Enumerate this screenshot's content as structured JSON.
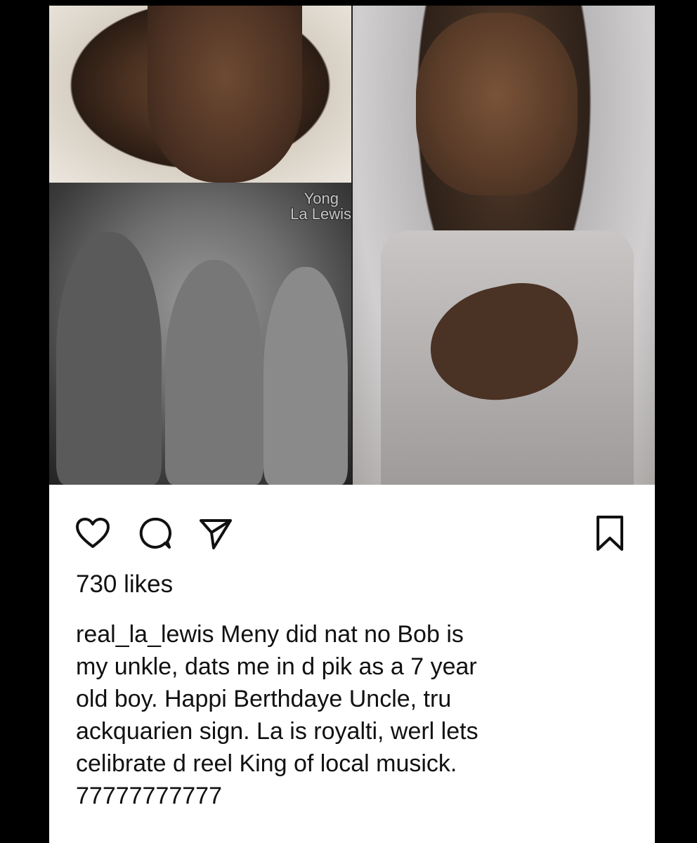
{
  "post": {
    "photo_label_line1": "Yong",
    "photo_label_line2": "La Lewis",
    "likes": "730 likes",
    "caption": {
      "username": "real_la_lewis",
      "lines": [
        " Meny did nat no Bob is",
        "my unkle, dats me in d pik as a 7 year",
        "old boy. Happi Berthdaye Uncle, tru",
        "ackquarien sign. La is royalti, werl lets",
        "celibrate d reel King of local musick.",
        "77777777777"
      ]
    }
  },
  "icons": {
    "like": "heart-icon",
    "comment": "comment-icon",
    "share": "send-icon",
    "save": "bookmark-icon"
  },
  "colors": {
    "background": "#000000",
    "card": "#ffffff",
    "text": "#111111",
    "label": "#f4c33c"
  }
}
